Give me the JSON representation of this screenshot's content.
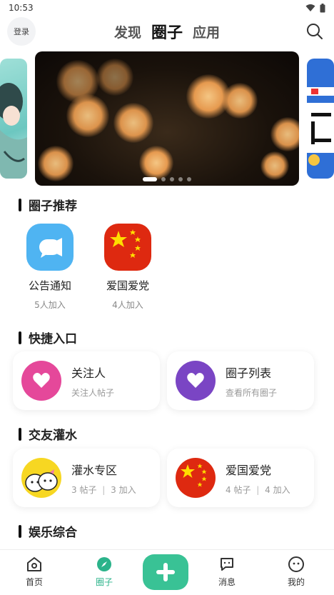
{
  "status_bar": {
    "time": "10:53"
  },
  "header": {
    "login_label": "登录",
    "tabs": [
      {
        "label": "发现",
        "active": false
      },
      {
        "label": "圈子",
        "active": true
      },
      {
        "label": "应用",
        "active": false
      }
    ]
  },
  "banner": {
    "slide_count": 5,
    "active_index": 0
  },
  "sections": {
    "recommend_title": "圈子推荐",
    "quick_title": "快捷入口",
    "social_title": "交友灌水",
    "entertainment_title": "娱乐综合"
  },
  "recommended_circles": [
    {
      "name": "公告通知",
      "count": "5人加入",
      "icon": "megaphone-icon",
      "color": "#4fb4f2"
    },
    {
      "name": "爱国爱党",
      "count": "4人加入",
      "icon": "china-flag-icon",
      "color": "#de2910"
    }
  ],
  "quick_entries": [
    {
      "title": "关注人",
      "subtitle": "关注人帖子",
      "icon": "heart-icon",
      "color": "#e5489a"
    },
    {
      "title": "圈子列表",
      "subtitle": "查看所有圈子",
      "icon": "heart-icon",
      "color": "#7a45c4"
    }
  ],
  "social_circles": [
    {
      "title": "灌水专区",
      "posts": "3 帖子",
      "members": "3 加入",
      "icon": "cartoon-icon",
      "color": "#f7d722"
    },
    {
      "title": "爱国爱党",
      "posts": "4 帖子",
      "members": "4 加入",
      "icon": "china-flag-icon",
      "color": "#de2910"
    }
  ],
  "separator": "|",
  "bottom_nav": [
    {
      "label": "首页",
      "icon": "home-icon",
      "active": false
    },
    {
      "label": "圈子",
      "icon": "compass-icon",
      "active": true
    },
    {
      "label": "",
      "icon": "plus-icon",
      "active": false
    },
    {
      "label": "消息",
      "icon": "chat-icon",
      "active": false
    },
    {
      "label": "我的",
      "icon": "face-icon",
      "active": false
    }
  ],
  "colors": {
    "accent": "#39c295",
    "active_tab": "#2bb38a"
  }
}
